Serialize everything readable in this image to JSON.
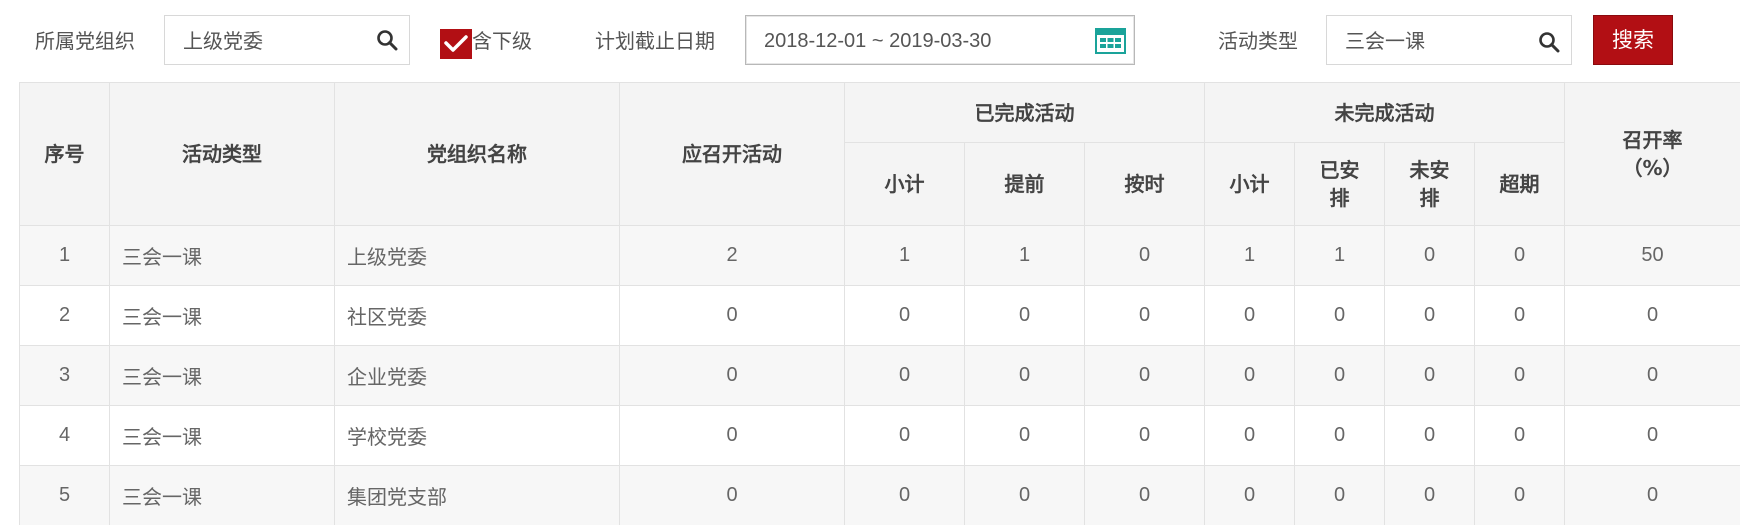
{
  "filters": {
    "org_label": "所属党组织",
    "org_value": "上级党委",
    "include_sub_label": "含下级",
    "include_sub_checked": true,
    "date_label": "计划截止日期",
    "date_range": "2018-12-01 ~ 2019-03-30",
    "type_label": "活动类型",
    "type_value": "三会一课",
    "search_label": "搜索"
  },
  "colors": {
    "accent": "#b20f14",
    "header_bg": "#f4f4f4",
    "border": "#e2e2e2",
    "calendar_icon": "#1aa39a"
  },
  "icons": {
    "search": "search-icon",
    "calendar": "calendar-icon",
    "check": "checkmark-icon"
  },
  "table": {
    "headers": {
      "index": "序号",
      "type": "活动类型",
      "org": "党组织名称",
      "planned": "应召开活动",
      "completed": "已完成活动",
      "incomplete": "未完成活动",
      "rate": "召开率",
      "rate_unit": "（%）",
      "completed_subtotal": "小计",
      "completed_early": "提前",
      "completed_ontime": "按时",
      "incomplete_subtotal": "小计",
      "incomplete_scheduled_1": "已安",
      "incomplete_scheduled_2": "排",
      "incomplete_unscheduled_1": "未安",
      "incomplete_unscheduled_2": "排",
      "incomplete_overdue": "超期"
    },
    "rows": [
      {
        "index": "1",
        "type": "三会一课",
        "org": "上级党委",
        "planned": "2",
        "c_sub": "1",
        "c_early": "1",
        "c_ontime": "0",
        "i_sub": "1",
        "i_sched": "1",
        "i_unsched": "0",
        "i_overdue": "0",
        "rate": "50"
      },
      {
        "index": "2",
        "type": "三会一课",
        "org": "社区党委",
        "planned": "0",
        "c_sub": "0",
        "c_early": "0",
        "c_ontime": "0",
        "i_sub": "0",
        "i_sched": "0",
        "i_unsched": "0",
        "i_overdue": "0",
        "rate": "0"
      },
      {
        "index": "3",
        "type": "三会一课",
        "org": "企业党委",
        "planned": "0",
        "c_sub": "0",
        "c_early": "0",
        "c_ontime": "0",
        "i_sub": "0",
        "i_sched": "0",
        "i_unsched": "0",
        "i_overdue": "0",
        "rate": "0"
      },
      {
        "index": "4",
        "type": "三会一课",
        "org": "学校党委",
        "planned": "0",
        "c_sub": "0",
        "c_early": "0",
        "c_ontime": "0",
        "i_sub": "0",
        "i_sched": "0",
        "i_unsched": "0",
        "i_overdue": "0",
        "rate": "0"
      },
      {
        "index": "5",
        "type": "三会一课",
        "org": "集团党支部",
        "planned": "0",
        "c_sub": "0",
        "c_early": "0",
        "c_ontime": "0",
        "i_sub": "0",
        "i_sched": "0",
        "i_unsched": "0",
        "i_overdue": "0",
        "rate": "0"
      }
    ]
  }
}
